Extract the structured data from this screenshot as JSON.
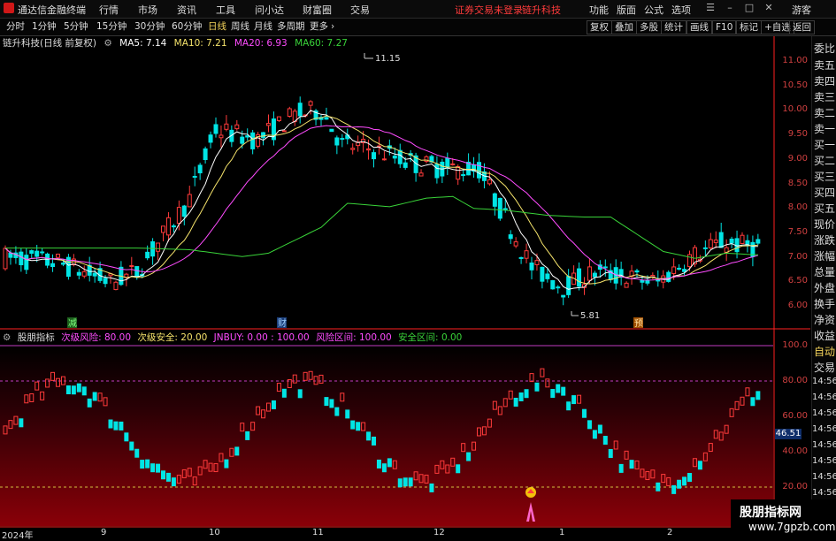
{
  "titlebar": {
    "app_name": "通达信金融终端",
    "menus": [
      "行情",
      "市场",
      "资讯",
      "工具",
      "问小达",
      "财富圈",
      "交易"
    ],
    "login_warning": "证券交易未登录",
    "stock_name": "链升科技",
    "right_menus": [
      "功能",
      "版面",
      "公式",
      "选项"
    ],
    "guest": "游客"
  },
  "periodbar": {
    "periods": [
      "分时",
      "1分钟",
      "5分钟",
      "15分钟",
      "30分钟",
      "60分钟",
      "日线",
      "周线",
      "月线",
      "多周期",
      "更多"
    ],
    "active_period": "日线",
    "tools": [
      "复权",
      "叠加",
      "多股",
      "统计",
      "画线",
      "F10",
      "标记",
      "+自选",
      "返回"
    ]
  },
  "info": {
    "title": "链升科技(日线 前复权)",
    "ma5": "MA5: 7.14",
    "ma10": "MA10: 7.21",
    "ma20": "MA20: 6.93",
    "ma60": "MA60: 7.27",
    "high_label": "11.15",
    "low_label": "5.81",
    "markers": [
      "减",
      "财",
      "预"
    ]
  },
  "indicator": {
    "name": "股朋指标",
    "fields": [
      "次级风险: 80.00",
      "次级安全: 20.00",
      "JNBUY: 0.00 : 100.00",
      "风险区间: 100.00",
      "安全区间: 0.00"
    ],
    "current_value": "46.51"
  },
  "sidebar": {
    "labels": [
      "委比",
      "卖五",
      "卖四",
      "卖三",
      "卖二",
      "卖一",
      "买一",
      "买二",
      "买三",
      "买四",
      "买五",
      "现价",
      "涨跌",
      "涨幅",
      "总量",
      "外盘",
      "换手",
      "净资",
      "收益"
    ],
    "auto": "自动",
    "trade": "交易",
    "times": [
      "14:56",
      "14:56",
      "14:56",
      "14:56",
      "14:56",
      "14:56",
      "14:56",
      "14:56"
    ]
  },
  "axes": {
    "price_ticks": [
      "11.00",
      "10.50",
      "10.00",
      "9.50",
      "9.00",
      "8.50",
      "8.00",
      "7.50",
      "7.00",
      "6.50",
      "6.00"
    ],
    "ind_ticks": [
      "100.0",
      "80.00",
      "60.00",
      "40.00",
      "20.00"
    ],
    "x_ticks": [
      "2024年",
      "9",
      "10",
      "11",
      "12",
      "1",
      "2"
    ]
  },
  "watermark": {
    "line1": "股朋指标网",
    "line2": "www.7gpzb.com"
  },
  "colors": {
    "up": "#ff3b3b",
    "down": "#00e5e5",
    "ma5": "#ffffff",
    "ma10": "#f5e36b",
    "ma20": "#ff4cff",
    "ma60": "#39d339",
    "accent": "#f3d25a"
  }
}
